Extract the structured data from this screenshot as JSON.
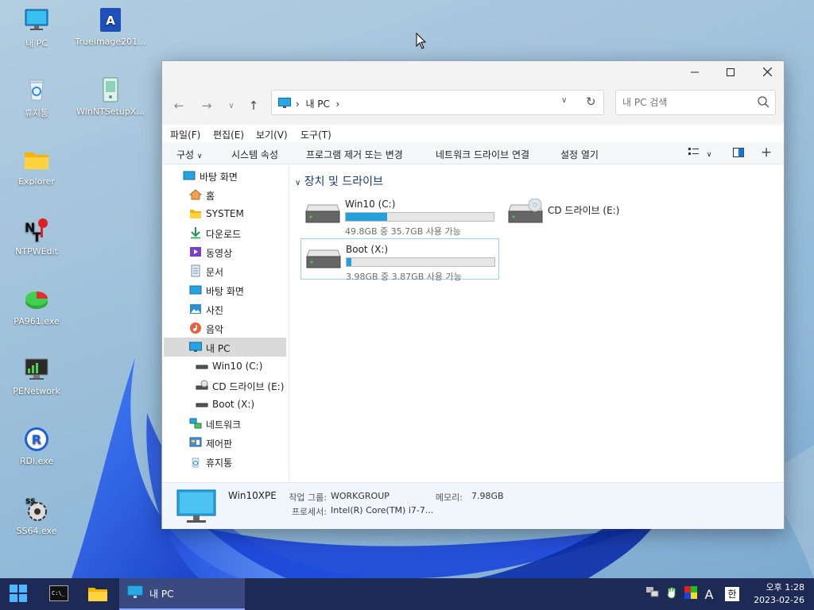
{
  "desktop": {
    "icons": [
      {
        "label": "내 PC",
        "icon": "monitor-icon"
      },
      {
        "label": "TrueImage201...",
        "icon": "acronis-icon"
      },
      {
        "label": "휴지통",
        "icon": "recycle-bin-icon"
      },
      {
        "label": "WinNTSetupX...",
        "icon": "setup-icon"
      },
      {
        "label": "Explorer",
        "icon": "folder-icon"
      },
      {
        "label": "NTPWEdit",
        "icon": "key-icon"
      },
      {
        "label": "PA961.exe",
        "icon": "partition-icon"
      },
      {
        "label": "PENetwork",
        "icon": "network-monitor-icon"
      },
      {
        "label": "RDI.exe",
        "icon": "rdi-icon"
      },
      {
        "label": "SS64.exe",
        "icon": "gear-icon"
      }
    ]
  },
  "window": {
    "search_placeholder": "내 PC 검색",
    "address": {
      "root_icon": "monitor-icon",
      "segments": [
        "내 PC"
      ]
    },
    "menu": [
      "파일(F)",
      "편집(E)",
      "보기(V)",
      "도구(T)"
    ],
    "commands": [
      "구성",
      "시스템 속성",
      "프로그램 제거 또는 변경",
      "네트워크 드라이브 연결",
      "설정 열기"
    ],
    "sidebar": [
      {
        "label": "바탕 화면",
        "icon": "desktop-icon"
      },
      {
        "label": "홈",
        "icon": "home-icon"
      },
      {
        "label": "SYSTEM",
        "icon": "folder-icon"
      },
      {
        "label": "다운로드",
        "icon": "download-icon"
      },
      {
        "label": "동영상",
        "icon": "video-icon"
      },
      {
        "label": "문서",
        "icon": "document-icon"
      },
      {
        "label": "바탕 화면",
        "icon": "desktop-icon"
      },
      {
        "label": "사진",
        "icon": "picture-icon"
      },
      {
        "label": "음악",
        "icon": "music-icon"
      },
      {
        "label": "내 PC",
        "icon": "monitor-icon"
      },
      {
        "label": "Win10 (C:)",
        "icon": "drive-icon"
      },
      {
        "label": "CD 드라이브 (E:)",
        "icon": "cd-drive-icon"
      },
      {
        "label": "Boot (X:)",
        "icon": "drive-icon"
      },
      {
        "label": "네트워크",
        "icon": "network-icon"
      },
      {
        "label": "제어판",
        "icon": "control-panel-icon"
      },
      {
        "label": "휴지통",
        "icon": "recycle-bin-icon"
      }
    ],
    "selected_sidebar": "내 PC",
    "group_title": "장치 및 드라이브",
    "drives": [
      {
        "name": "Win10 (C:)",
        "usage": "49.8GB 중 35.7GB 사용 가능",
        "used_fraction": 0.28
      },
      {
        "name": "CD 드라이브 (E:)"
      },
      {
        "name": "Boot (X:)",
        "usage": "3.98GB 중 3.87GB 사용 가능",
        "used_fraction": 0.03
      }
    ],
    "details": {
      "computer_name": "Win10XPE",
      "workgroup_label": "작업 그룹:",
      "workgroup_value": "WORKGROUP",
      "memory_label": "메모리:",
      "memory_value": "7.98GB",
      "processor_label": "프로세서:",
      "processor_value": "Intel(R) Core(TM) i7-7..."
    }
  },
  "taskbar": {
    "active_window": "내 PC",
    "ime_lang": "A",
    "ime_mode": "한",
    "time": "오후 1:28",
    "date": "2023-02-26"
  },
  "colors": {
    "accent": "#26a0da",
    "taskbar": "#1d2a55",
    "selection": "#99d1ff"
  }
}
